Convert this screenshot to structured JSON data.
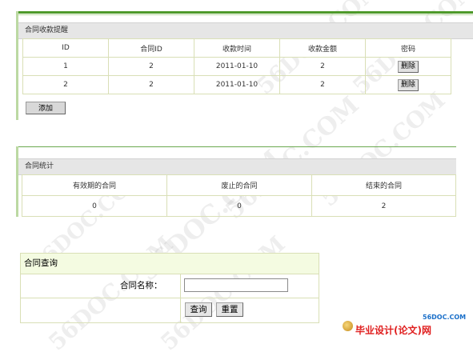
{
  "reminder": {
    "title": "合同收款提醒",
    "columns": [
      "ID",
      "合同ID",
      "收款时间",
      "收款金额",
      "密码"
    ],
    "rows": [
      {
        "id": "1",
        "contract_id": "2",
        "date": "2011-01-10",
        "amount": "2",
        "action": "删除"
      },
      {
        "id": "2",
        "contract_id": "2",
        "date": "2011-01-10",
        "amount": "2",
        "action": "删除"
      }
    ],
    "add_label": "添加"
  },
  "stats": {
    "title": "合同统计",
    "columns": [
      "有效期的合同",
      "废止的合同",
      "结束的合同"
    ],
    "values": [
      "0",
      "0",
      "2"
    ]
  },
  "search": {
    "title": "合同查询",
    "name_label": "合同名称：",
    "name_value": "",
    "query_label": "查询",
    "reset_label": "重置"
  },
  "watermark": "56DOC.COM",
  "logo": {
    "site": "56DOC.COM",
    "text": "毕业设计(论文)网"
  }
}
